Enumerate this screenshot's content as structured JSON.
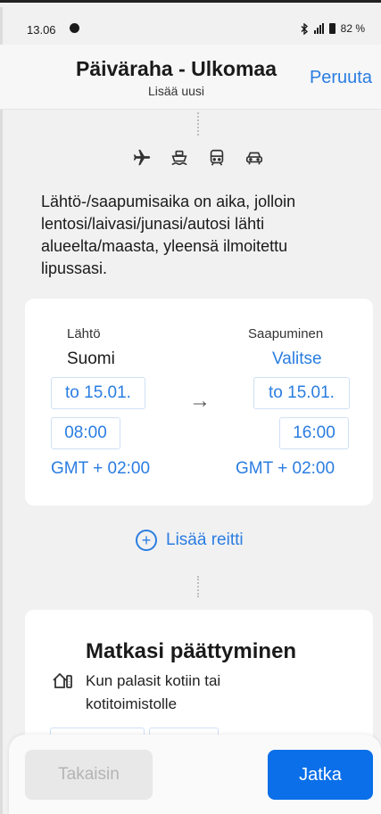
{
  "status_bar": {
    "time": "13.06",
    "battery": "82 %"
  },
  "header": {
    "title": "Päiväraha - Ulkomaa",
    "subtitle": "Lisää uusi",
    "cancel_label": "Peruuta"
  },
  "transport_icons": [
    "plane-icon",
    "boat-icon",
    "train-icon",
    "car-icon"
  ],
  "info_text": "Lähtö-/saapumisaika on aika, jolloin lentosi/laivasi/junasi/autosi lähti alueelta/maasta, yleensä ilmoitettu lipussasi.",
  "route": {
    "departure": {
      "label": "Lähtö",
      "country": "Suomi",
      "date": "to 15.01.",
      "time": "08:00",
      "timezone": "GMT + 02:00"
    },
    "arrival": {
      "label": "Saapuminen",
      "country": "Valitse",
      "date": "to 15.01.",
      "time": "16:00",
      "timezone": "GMT + 02:00"
    }
  },
  "add_route_label": "Lisää reitti",
  "trip_end": {
    "title": "Matkasi päättyminen",
    "description": "Kun palasit kotiin tai kotitoimistolle"
  },
  "footer": {
    "back_label": "Takaisin",
    "next_label": "Jatka"
  },
  "colors": {
    "accent": "#2a7de1",
    "primary_button": "#0a6fe8",
    "disabled_button": "#e8e8e8"
  }
}
